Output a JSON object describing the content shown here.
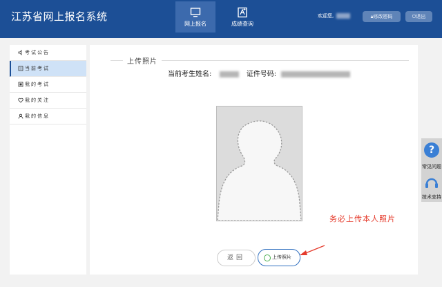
{
  "header": {
    "app_title": "江苏省网上报名系统",
    "nav": [
      {
        "label": "网上报名",
        "icon": "monitor-icon",
        "active": true
      },
      {
        "label": "成绩查询",
        "icon": "score-query-icon",
        "active": false
      }
    ],
    "welcome": "欢迎您,",
    "change_password": "修改密码",
    "logout": "退出"
  },
  "sidebar": {
    "items": [
      {
        "label": "考试公告",
        "icon": "speaker-icon",
        "active": false
      },
      {
        "label": "当前考试",
        "icon": "document-icon",
        "active": true
      },
      {
        "label": "我的考试",
        "icon": "exam-icon",
        "active": false
      },
      {
        "label": "我的关注",
        "icon": "heart-icon",
        "active": false
      },
      {
        "label": "我的信息",
        "icon": "user-icon",
        "active": false
      }
    ]
  },
  "main": {
    "section_title": "上传照片",
    "name_label": "当前考生姓名:",
    "id_label": "证件号码:",
    "warning": "务必上传本人照片",
    "back_button": "返回",
    "upload_button": "上传照片"
  },
  "float_panel": {
    "faq": "常见问题",
    "support": "技术支持"
  },
  "colors": {
    "header_bg": "#1c4f96",
    "warning": "#e53b2c",
    "accent": "#2f6fbf"
  }
}
